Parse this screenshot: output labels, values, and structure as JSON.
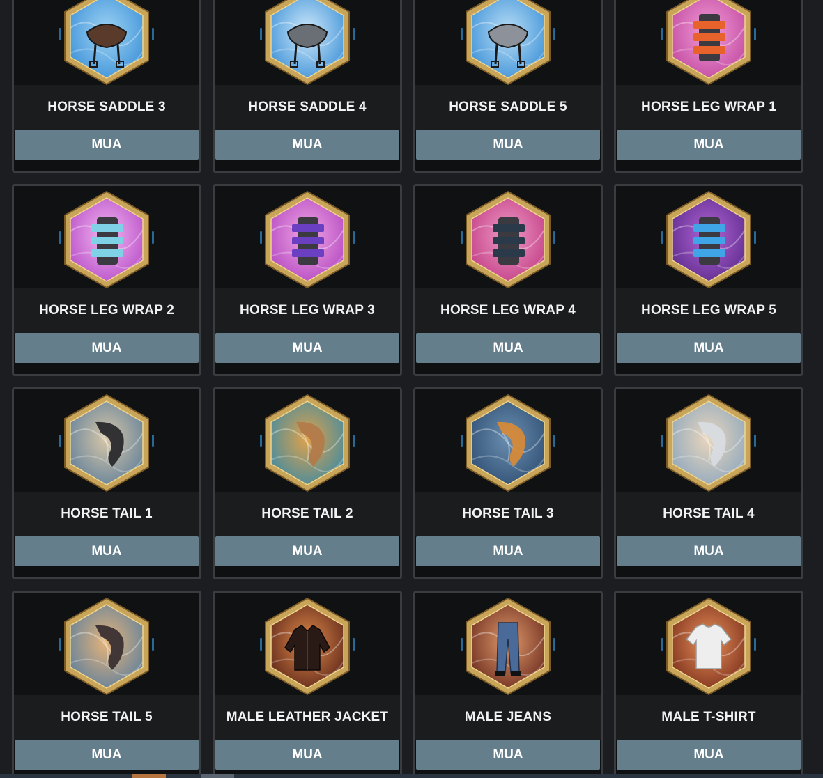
{
  "buy_label": "MUA",
  "items": [
    {
      "name": "HORSE SADDLE 3",
      "icon": "saddle-icon",
      "bg": [
        "#3a8fd6",
        "#9fd4f5"
      ],
      "item": "#5a3a2a"
    },
    {
      "name": "HORSE SADDLE 4",
      "icon": "saddle-icon",
      "bg": [
        "#3a8fd6",
        "#cfe9fa"
      ],
      "item": "#6a6f76"
    },
    {
      "name": "HORSE SADDLE 5",
      "icon": "saddle-icon",
      "bg": [
        "#3a8fd6",
        "#b9def6"
      ],
      "item": "#8d929a"
    },
    {
      "name": "HORSE LEG WRAP 1",
      "icon": "leg-wrap-icon",
      "bg": [
        "#c0479f",
        "#f29cd6"
      ],
      "item": "#e8622c"
    },
    {
      "name": "HORSE LEG WRAP 2",
      "icon": "leg-wrap-icon",
      "bg": [
        "#b54bc8",
        "#f3b6ee"
      ],
      "item": "#7fd2e6"
    },
    {
      "name": "HORSE LEG WRAP 3",
      "icon": "leg-wrap-icon",
      "bg": [
        "#b246c0",
        "#f0a5e4"
      ],
      "item": "#6a3fc2"
    },
    {
      "name": "HORSE LEG WRAP 4",
      "icon": "leg-wrap-icon",
      "bg": [
        "#c03c84",
        "#f09ac6"
      ],
      "item": "#2a3a4a"
    },
    {
      "name": "HORSE LEG WRAP 5",
      "icon": "leg-wrap-icon",
      "bg": [
        "#5a2a8a",
        "#b264d6"
      ],
      "item": "#3fa5e6"
    },
    {
      "name": "HORSE TAIL 1",
      "icon": "horse-tail-icon",
      "bg": [
        "#5e7e9a",
        "#d8c7a8"
      ],
      "item": "#2a2a2e"
    },
    {
      "name": "HORSE TAIL 2",
      "icon": "horse-tail-icon",
      "bg": [
        "#3a8aa6",
        "#e0a24a"
      ],
      "item": "#b27a4a"
    },
    {
      "name": "HORSE TAIL 3",
      "icon": "horse-tail-icon",
      "bg": [
        "#2e4e72",
        "#6a8eb0"
      ],
      "item": "#d68a3a"
    },
    {
      "name": "HORSE TAIL 4",
      "icon": "horse-tail-icon",
      "bg": [
        "#8aa6be",
        "#ead6bc"
      ],
      "item": "#d8dce0"
    },
    {
      "name": "HORSE TAIL 5",
      "icon": "horse-tail-icon",
      "bg": [
        "#5a7e9e",
        "#e6b47a"
      ],
      "item": "#3a3032"
    },
    {
      "name": "MALE LEATHER JACKET",
      "icon": "jacket-icon",
      "bg": [
        "#5a2418",
        "#e08a4a"
      ],
      "item": "#2a1a16"
    },
    {
      "name": "MALE JEANS",
      "icon": "jeans-icon",
      "bg": [
        "#6a2a1e",
        "#e09a6a"
      ],
      "item": "#4a6a9a"
    },
    {
      "name": "MALE T-SHIRT",
      "icon": "tshirt-icon",
      "bg": [
        "#7a2e1a",
        "#e8905a"
      ],
      "item": "#eeeeee"
    }
  ]
}
